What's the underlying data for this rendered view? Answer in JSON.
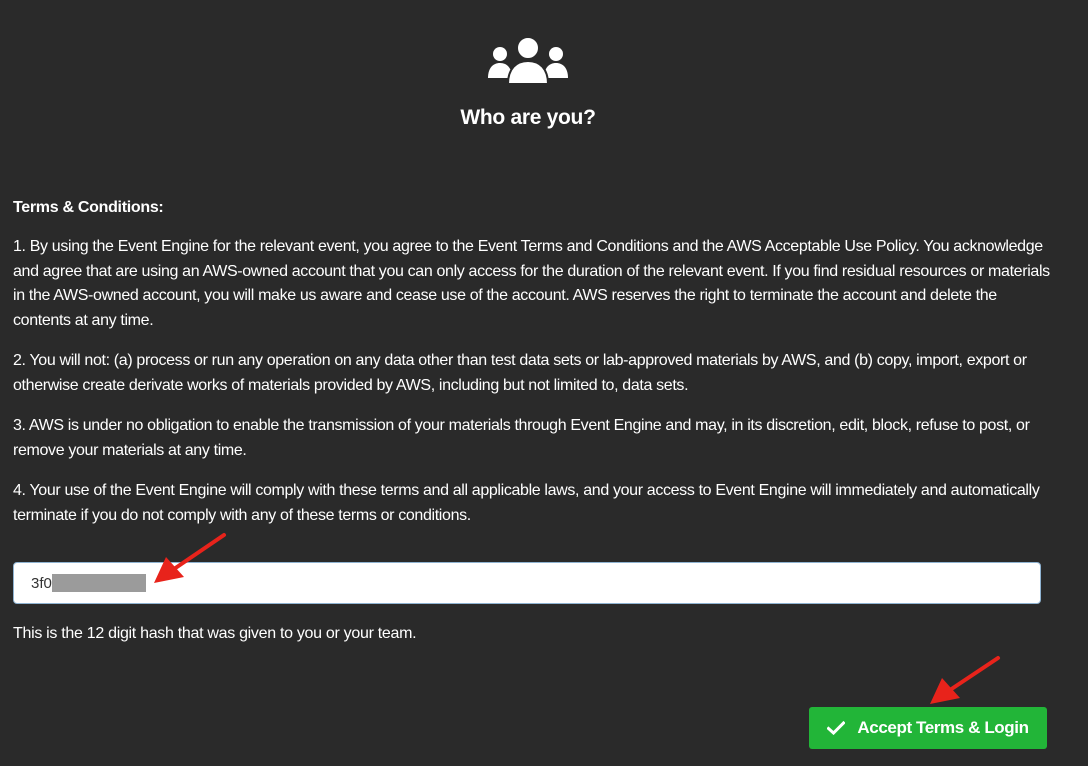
{
  "header": {
    "icon": "users-icon",
    "title": "Who are you?"
  },
  "terms": {
    "heading": "Terms & Conditions:",
    "paragraphs": [
      "1. By using the Event Engine for the relevant event, you agree to the Event Terms and Conditions and the AWS Acceptable Use Policy. You acknowledge and agree that are using an AWS-owned account that you can only access for the duration of the relevant event. If you find residual resources or materials in the AWS-owned account, you will make us aware and cease use of the account. AWS reserves the right to terminate the account and delete the contents at any time.",
      "2. You will not: (a) process or run any operation on any data other than test data sets or lab-approved materials by AWS, and (b) copy, import, export or otherwise create derivate works of materials provided by AWS, including but not limited to, data sets.",
      "3. AWS is under no obligation to enable the transmission of your materials through Event Engine and may, in its discretion, edit, block, refuse to post, or remove your materials at any time.",
      "4. Your use of the Event Engine will comply with these terms and all applicable laws, and your access to Event Engine will immediately and automatically terminate if you do not comply with any of these terms or conditions."
    ]
  },
  "hash_field": {
    "value": "3f0"
  },
  "hint": "This is the 12 digit hash that was given to you or your team.",
  "accept_button": {
    "label": "Accept Terms & Login",
    "icon": "check-icon"
  },
  "colors": {
    "background": "#2a2a2a",
    "button": "#22b538",
    "annotation_arrow": "#e8231b"
  }
}
